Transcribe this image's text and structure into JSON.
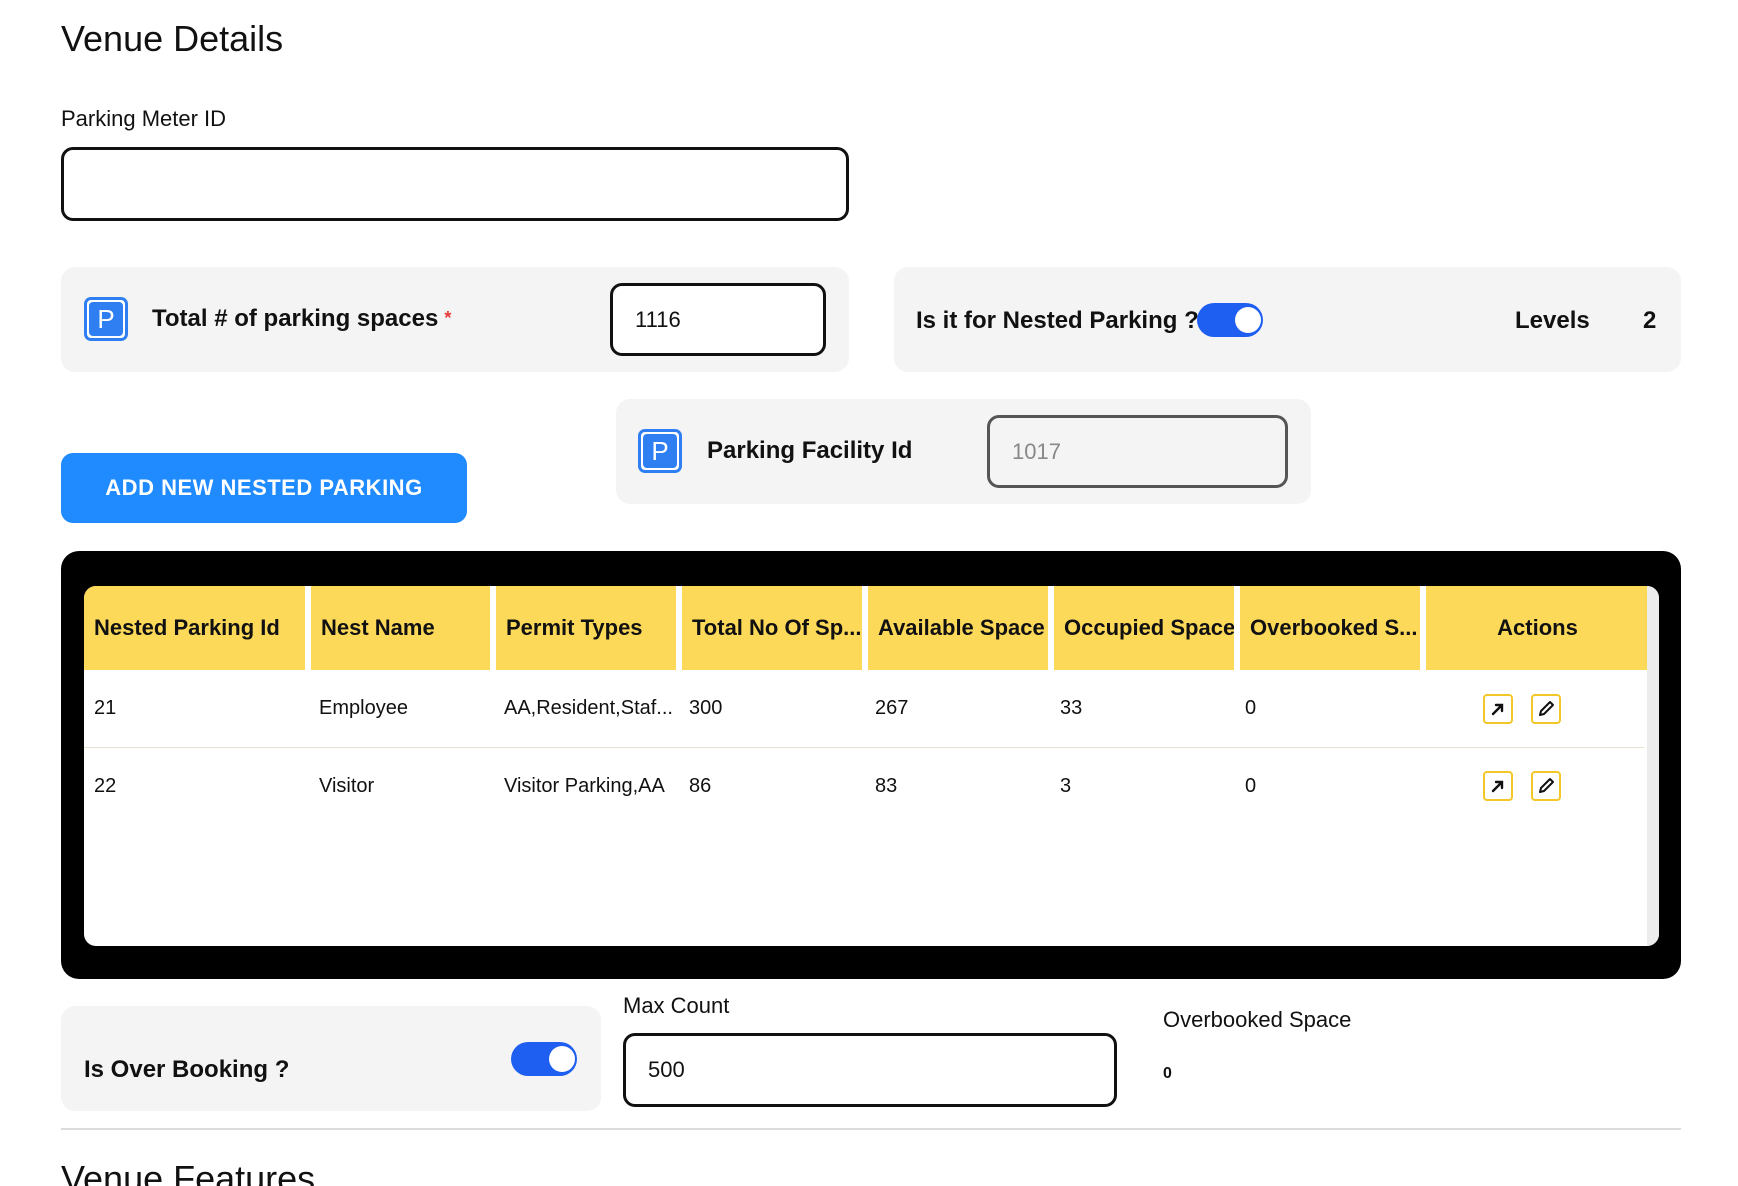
{
  "venue_details": {
    "title": "Venue Details",
    "parking_meter": {
      "label": "Parking Meter ID",
      "value": ""
    },
    "total_spaces": {
      "label": "Total # of parking spaces",
      "required_mark": "*",
      "value": "1116",
      "icon": "parking-icon"
    },
    "nested": {
      "label": "Is it for Nested Parking ?",
      "enabled": true,
      "levels_label": "Levels",
      "levels_value": "2"
    },
    "facility": {
      "label": "Parking Facility Id",
      "value": "1017",
      "icon": "parking-icon"
    },
    "add_button": "ADD NEW NESTED PARKING"
  },
  "table": {
    "columns": [
      "Nested Parking Id",
      "Nest Name",
      "Permit Types",
      "Total No Of Sp...",
      "Available Space",
      "Occupied Space",
      "Overbooked S...",
      "Actions"
    ],
    "rows": [
      {
        "id": "21",
        "name": "Employee",
        "permits": "AA,Resident,Staf...",
        "total": "300",
        "available": "267",
        "occupied": "33",
        "overbooked": "0"
      },
      {
        "id": "22",
        "name": "Visitor",
        "permits": "Visitor Parking,AA",
        "total": "86",
        "available": "83",
        "occupied": "3",
        "overbooked": "0"
      }
    ],
    "action_icons": [
      "open-external-icon",
      "edit-icon"
    ]
  },
  "overbooking": {
    "label": "Is Over Booking ?",
    "enabled": true,
    "max_count_label": "Max Count",
    "max_count_value": "500",
    "overbooked_label": "Overbooked Space",
    "overbooked_value": "0"
  },
  "venue_features": {
    "title": "Venue Features"
  },
  "colors": {
    "accent_blue": "#1f8bff",
    "toggle_blue": "#1e5ef0",
    "header_yellow": "#fdd95a",
    "icon_blue": "#2f7ff2"
  }
}
